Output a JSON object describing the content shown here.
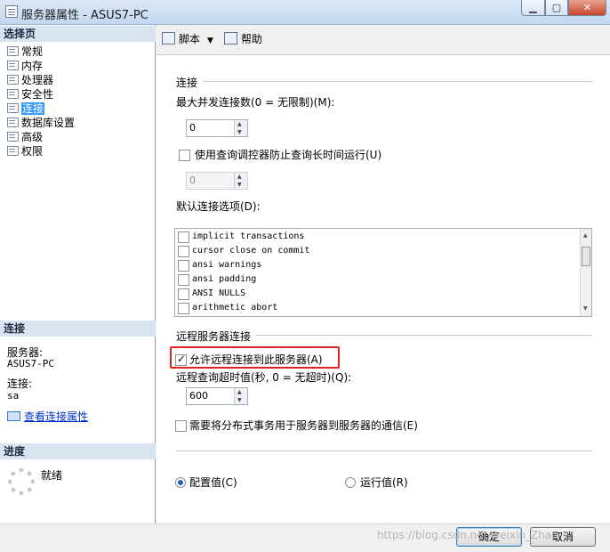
{
  "window": {
    "title": "服务器属性 - ASUS7-PC",
    "min_glyph": "▁",
    "max_glyph": "▢",
    "close_glyph": "✕"
  },
  "left": {
    "select_page_header": "选择页",
    "pages": [
      "常规",
      "内存",
      "处理器",
      "安全性",
      "连接",
      "数据库设置",
      "高级",
      "权限"
    ],
    "selected_page": "连接",
    "connection_header": "连接",
    "server_label": "服务器:",
    "server_value": "ASUS7-PC",
    "conn_label": "连接:",
    "conn_value": "sa",
    "view_conn_props": "查看连接属性",
    "progress_header": "进度",
    "status": "就绪"
  },
  "toolbar": {
    "script_label": "脚本",
    "dropdown_glyph": "▼",
    "help_label": "帮助"
  },
  "connections": {
    "group_title": "连接",
    "max_conn_label": "最大并发连接数(0 = 无限制)(M):",
    "max_conn_value": "0",
    "governor_label": "使用查询调控器防止查询长时间运行(U)",
    "governor_checked": false,
    "governor_value": "0",
    "default_opts_label": "默认连接选项(D):",
    "options": [
      {
        "label": "implicit transactions",
        "checked": false
      },
      {
        "label": "cursor close on commit",
        "checked": false
      },
      {
        "label": "ansi warnings",
        "checked": false
      },
      {
        "label": "ansi padding",
        "checked": false
      },
      {
        "label": "ANSI NULLS",
        "checked": false
      },
      {
        "label": "arithmetic abort",
        "checked": false
      }
    ]
  },
  "remote": {
    "group_title": "远程服务器连接",
    "allow_remote_label": "允许远程连接到此服务器(A)",
    "allow_remote_checked": true,
    "timeout_label": "远程查询超时值(秒, 0 = 无超时)(Q):",
    "timeout_value": "600",
    "distributed_label": "需要将分布式事务用于服务器到服务器的通信(E)",
    "distributed_checked": false
  },
  "mode": {
    "configured_label": "配置值(C)",
    "running_label": "运行值(R)",
    "selected": "configured"
  },
  "buttons": {
    "ok": "确定",
    "cancel": "取消"
  },
  "watermark": "https://blog.csdn.net/weixin_Zhao",
  "colors": {
    "selection": "#3399ff",
    "highlight_border": "#e02424",
    "link": "#0033cc"
  }
}
